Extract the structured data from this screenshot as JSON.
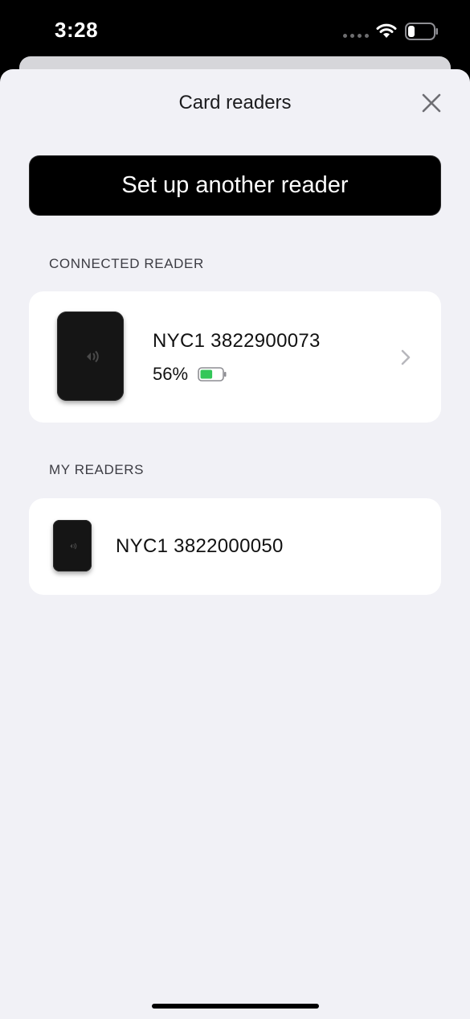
{
  "status_bar": {
    "time": "3:28"
  },
  "sheet": {
    "title": "Card readers",
    "setup_button_label": "Set up another reader"
  },
  "connected": {
    "section_label": "CONNECTED READER",
    "reader": {
      "name": "NYC1 3822900073",
      "battery_text": "56%",
      "battery_level": 0.56
    }
  },
  "my_readers": {
    "section_label": "MY READERS",
    "items": [
      {
        "name": "NYC1 3822000050"
      }
    ]
  },
  "colors": {
    "battery_green": "#34c759",
    "button_bg": "#000000",
    "sheet_bg": "#f1f1f6"
  },
  "icons": [
    "signal-icon",
    "wifi-icon",
    "battery-icon",
    "close-icon",
    "contactless-icon",
    "chevron-right-icon"
  ]
}
